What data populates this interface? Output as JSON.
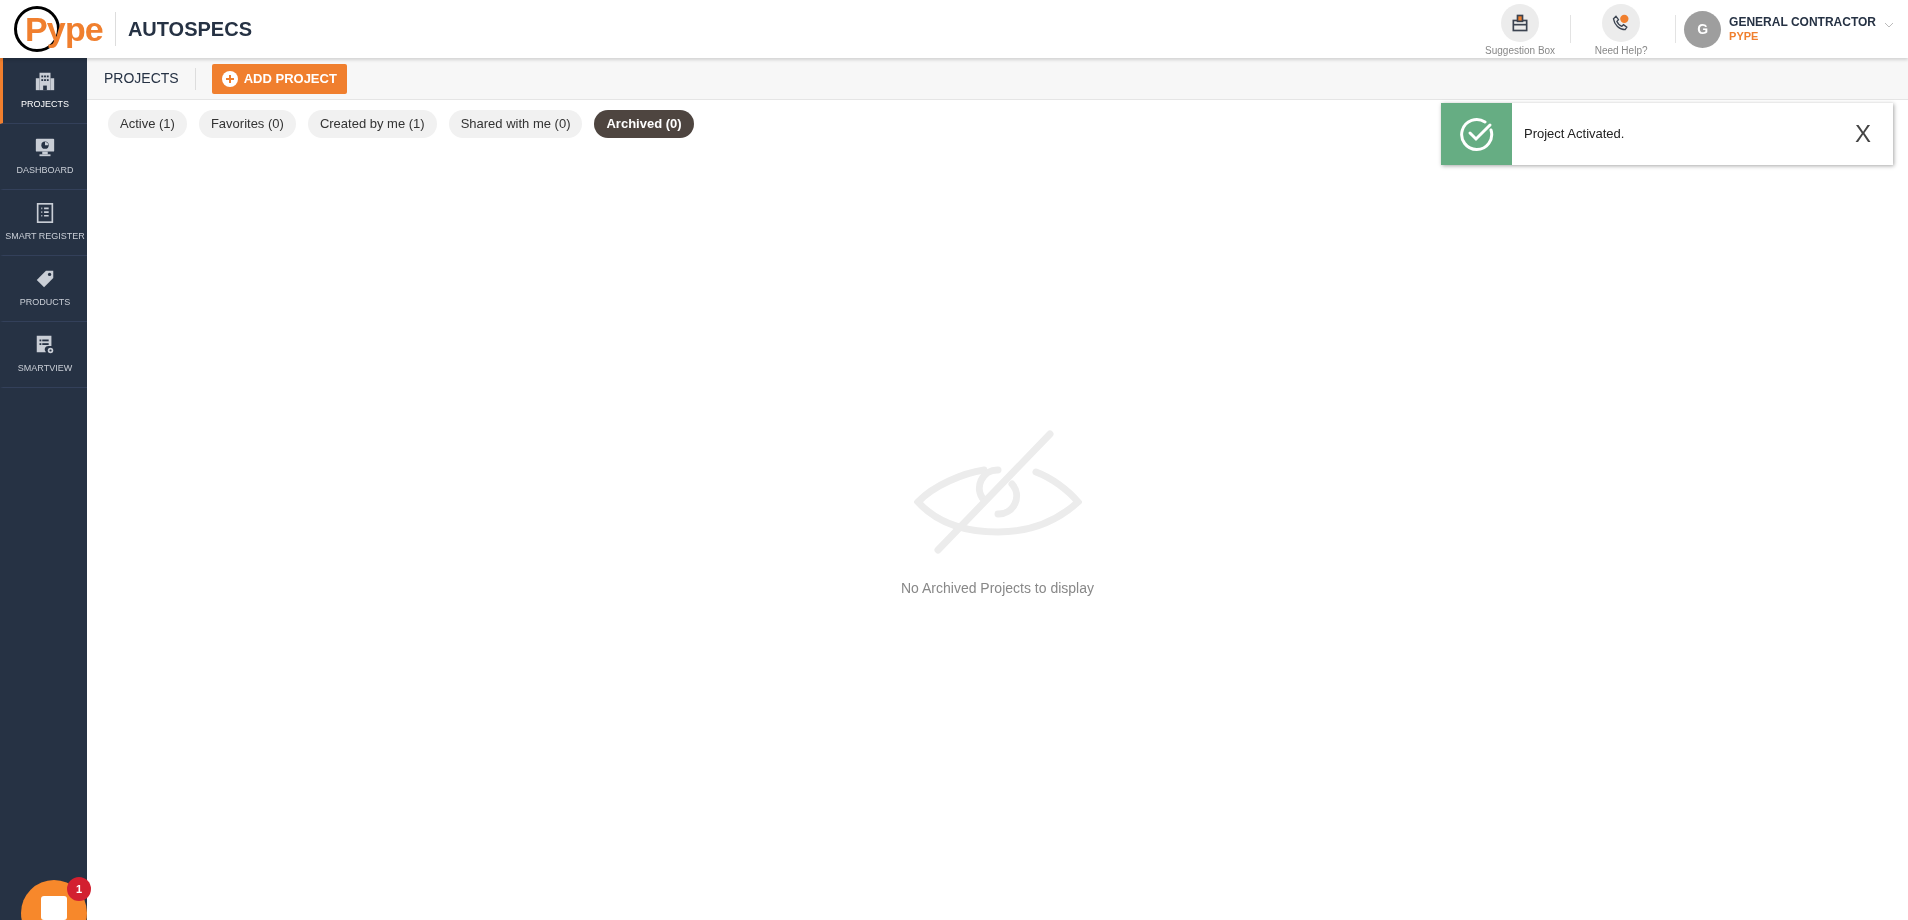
{
  "header": {
    "logo": "Pype",
    "product": "AUTOSPECS",
    "actions": [
      {
        "label": "Suggestion Box",
        "kind": "suggestion"
      },
      {
        "label": "Need Help?",
        "kind": "help"
      }
    ],
    "user": {
      "initial": "G",
      "name": "GENERAL CONTRACTOR",
      "company": "PYPE"
    }
  },
  "sidebar": {
    "items": [
      {
        "label": "PROJECTS",
        "kind": "building",
        "selected": true
      },
      {
        "label": "DASHBOARD",
        "kind": "monitor",
        "selected": false
      },
      {
        "label": "SMART REGISTER",
        "kind": "register",
        "selected": false
      },
      {
        "label": "PRODUCTS",
        "kind": "tag",
        "selected": false
      },
      {
        "label": "SMARTVIEW",
        "kind": "view",
        "selected": false
      }
    ]
  },
  "toolbar": {
    "title": "PROJECTS",
    "add_button": "ADD PROJECT"
  },
  "filters": [
    {
      "label": "Active (1)",
      "selected": false
    },
    {
      "label": "Favorites (0)",
      "selected": false
    },
    {
      "label": "Created by me (1)",
      "selected": false
    },
    {
      "label": "Shared with me (0)",
      "selected": false
    },
    {
      "label": "Archived (0)",
      "selected": true
    }
  ],
  "empty_state": {
    "message": "No Archived Projects to display"
  },
  "toast": {
    "message": "Project Activated.",
    "close": "X"
  },
  "chat": {
    "badge": "1"
  }
}
